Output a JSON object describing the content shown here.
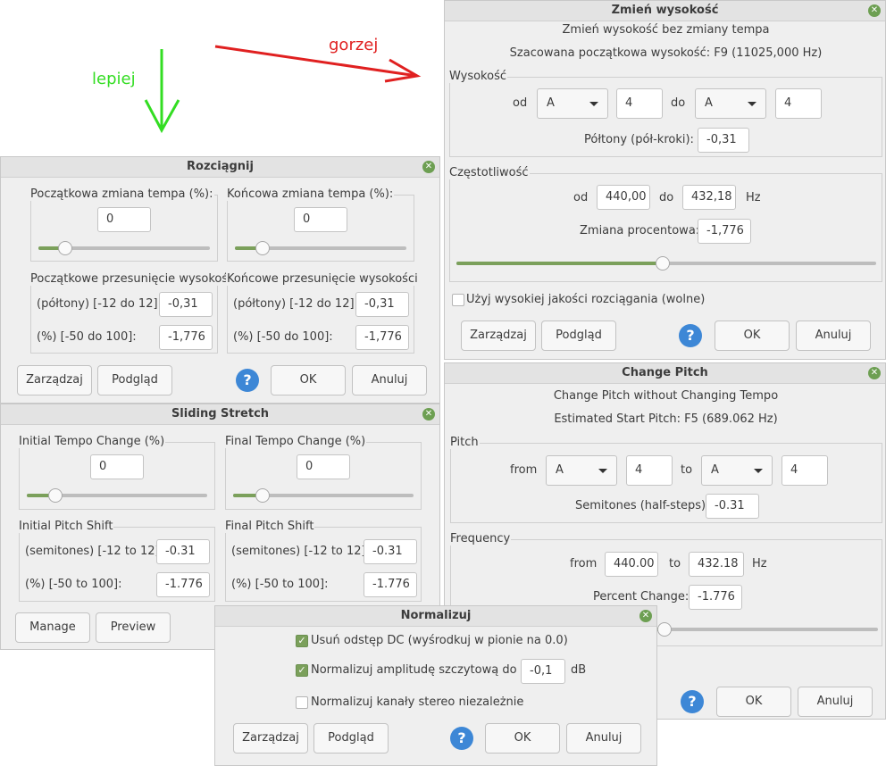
{
  "annotations": {
    "lepiej": "lepiej",
    "gorzej": "gorzej",
    "green": "#33dd22",
    "red": "#e02020"
  },
  "zmien": {
    "title": "Zmień wysokość",
    "subtitle": "Zmień wysokość bez zmiany tempa",
    "estimated": "Szacowana początkowa wysokość: F9 (11025,000 Hz)",
    "pitch_legend": "Wysokość",
    "from_label": "od",
    "from_note": "A",
    "from_octave": "4",
    "to_label": "do",
    "to_note": "A",
    "to_octave": "4",
    "semitones_label": "Półtony (pół-kroki):",
    "semitones_value": "-0,31",
    "freq_legend": "Częstotliwość",
    "freq_from_label": "od",
    "freq_from": "440,00",
    "freq_to_label": "do",
    "freq_to": "432,18",
    "hz": "Hz",
    "percent_label": "Zmiana procentowa:",
    "percent_value": "-1,776",
    "slider_fraction": 0.49,
    "hq_label": "Użyj wysokiej jakości rozciągania (wolne)",
    "manage": "Zarządzaj",
    "preview": "Podgląd",
    "help": "?",
    "ok": "OK",
    "cancel": "Anuluj"
  },
  "rozciagnij": {
    "title": "Rozciągnij",
    "init_tempo_legend": "Początkowa zmiana tempa (%):",
    "init_tempo_value": "0",
    "final_tempo_legend": "Końcowa zmiana tempa (%):",
    "final_tempo_value": "0",
    "init_pitch_legend": "Początkowe przesunięcie wysokości",
    "final_pitch_legend": "Końcowe przesunięcie wysokości",
    "semitones_label": "(półtony) [-12 do 12]:",
    "init_semitones": "-0,31",
    "final_semitones": "-0,31",
    "percent_label": "(%) [-50 do 100]:",
    "init_percent": "-1,776",
    "final_percent": "-1,776",
    "manage": "Zarządzaj",
    "preview": "Podgląd",
    "help": "?",
    "ok": "OK",
    "cancel": "Anuluj"
  },
  "sliding": {
    "title": "Sliding Stretch",
    "init_tempo_legend": "Initial Tempo Change (%)",
    "init_tempo_value": "0",
    "final_tempo_legend": "Final Tempo Change (%)",
    "final_tempo_value": "0",
    "init_pitch_legend": "Initial Pitch Shift",
    "final_pitch_legend": "Final Pitch Shift",
    "semitones_label": "(semitones) [-12 to 12]:",
    "init_semitones": "-0.31",
    "final_semitones": "-0.31",
    "percent_label": "(%) [-50 to 100]:",
    "init_percent": "-1.776",
    "final_percent": "-1.776",
    "manage": "Manage",
    "preview": "Preview"
  },
  "change_pitch": {
    "title": "Change Pitch",
    "subtitle": "Change Pitch without Changing Tempo",
    "estimated": "Estimated Start Pitch: F5 (689.062 Hz)",
    "pitch_legend": "Pitch",
    "from_label": "from",
    "from_note": "A",
    "from_octave": "4",
    "to_label": "to",
    "to_note": "A",
    "to_octave": "4",
    "semitones_label": "Semitones (half-steps):",
    "semitones_value": "-0.31",
    "freq_legend": "Frequency",
    "freq_from_label": "from",
    "freq_from": "440.00",
    "freq_to_label": "to",
    "freq_to": "432.18",
    "hz": "Hz",
    "percent_label": "Percent Change:",
    "percent_value": "-1.776",
    "help": "?",
    "ok": "OK",
    "cancel": "Anuluj"
  },
  "normalizuj": {
    "title": "Normalizuj",
    "dc_label": "Usuń odstęp DC (wyśrodkuj w pionie na 0.0)",
    "peak_label": "Normalizuj amplitudę szczytową do",
    "peak_value": "-0,1",
    "db": "dB",
    "stereo_label": "Normalizuj kanały stereo niezależnie",
    "dc_checked": true,
    "peak_checked": true,
    "stereo_checked": false,
    "manage": "Zarządzaj",
    "preview": "Podgląd",
    "help": "?",
    "ok": "OK",
    "cancel": "Anuluj"
  }
}
